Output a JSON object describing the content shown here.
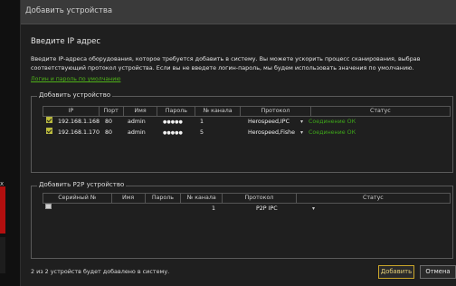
{
  "window_title": "Добавить устройства",
  "heading": "Введите IP адрес",
  "description": "Введите IP-адреса оборудования, которое требуется добавить в систему. Вы можете ускорить процесс сканирования, выбрав соответствующий протокол устройства. Если вы не введете логин-пароль, мы будем использовать значения по умолчанию.",
  "link": "Логин и пароль по умолчанию",
  "add_device": {
    "legend": "Добавить устройство",
    "columns": [
      "IP",
      "Порт",
      "Имя",
      "Пароль",
      "№ канала",
      "Протокол",
      "Статус"
    ],
    "rows": [
      {
        "checked": true,
        "ip": "192.168.1.168",
        "port": "80",
        "name": "admin",
        "password": "●●●●●",
        "channel": "1",
        "protocol": "Herospeed,IPC",
        "status": "Соединение ОК"
      },
      {
        "checked": true,
        "ip": "192.168.1.170",
        "port": "80",
        "name": "admin",
        "password": "●●●●●",
        "channel": "5",
        "protocol": "Herospeed,Fishe",
        "status": "Соединение ОК"
      }
    ]
  },
  "add_p2p": {
    "legend": "Добавить P2P устройство",
    "columns": [
      "Серийный №",
      "Имя",
      "Пароль",
      "№ канала",
      "Протокол",
      "Статус"
    ],
    "rows": [
      {
        "checked": false,
        "serial": "",
        "name": "",
        "password": "",
        "channel": "1",
        "protocol": "P2P IPC",
        "status": ""
      }
    ]
  },
  "bottom_status": "2 из 2 устройств будет добавлено в систему.",
  "buttons": {
    "add": "Добавить",
    "cancel": "Отмена"
  },
  "left_panel": {
    "close_glyph": "x"
  },
  "dropdown_glyph": "▾",
  "colors": {
    "accent": "#c9a52a",
    "status_ok": "#3ea51a",
    "link": "#4fb318"
  }
}
